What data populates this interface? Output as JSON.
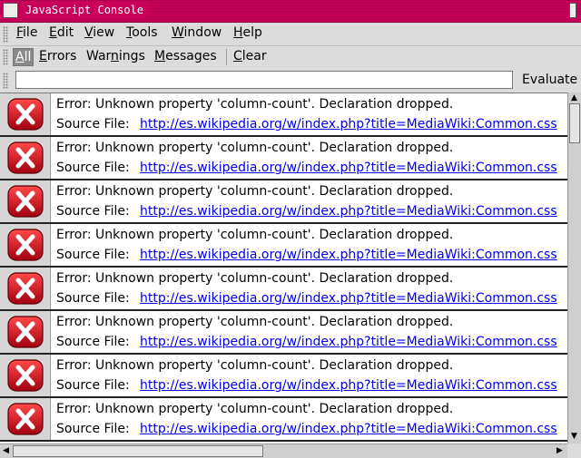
{
  "window": {
    "title": "JavaScript Console"
  },
  "menu": {
    "items": [
      "File",
      "Edit",
      "View",
      "Tools",
      "Window",
      "Help"
    ]
  },
  "filters": {
    "items": [
      "All",
      "Errors",
      "Warnings",
      "Messages"
    ],
    "active": "All",
    "clear_label": "Clear"
  },
  "evaluate": {
    "input_value": "",
    "button_label": "Evaluate"
  },
  "entries": [
    {
      "type": "error-icon",
      "message": "Error:  Unknown property 'column-count'. Declaration dropped.",
      "source_label": "Source File:",
      "source_url": "http://es.wikipedia.org/w/index.php?title=MediaWiki:Common.css"
    },
    {
      "type": "error-icon",
      "message": "Error:  Unknown property 'column-count'. Declaration dropped.",
      "source_label": "Source File:",
      "source_url": "http://es.wikipedia.org/w/index.php?title=MediaWiki:Common.css"
    },
    {
      "type": "error-icon",
      "message": "Error:  Unknown property 'column-count'. Declaration dropped.",
      "source_label": "Source File:",
      "source_url": "http://es.wikipedia.org/w/index.php?title=MediaWiki:Common.css"
    },
    {
      "type": "error-icon",
      "message": "Error:  Unknown property 'column-count'. Declaration dropped.",
      "source_label": "Source File:",
      "source_url": "http://es.wikipedia.org/w/index.php?title=MediaWiki:Common.css"
    },
    {
      "type": "error-icon",
      "message": "Error:  Unknown property 'column-count'. Declaration dropped.",
      "source_label": "Source File:",
      "source_url": "http://es.wikipedia.org/w/index.php?title=MediaWiki:Common.css"
    },
    {
      "type": "error-icon",
      "message": "Error:  Unknown property 'column-count'. Declaration dropped.",
      "source_label": "Source File:",
      "source_url": "http://es.wikipedia.org/w/index.php?title=MediaWiki:Common.css"
    },
    {
      "type": "error-icon",
      "message": "Error:  Unknown property 'column-count'. Declaration dropped.",
      "source_label": "Source File:",
      "source_url": "http://es.wikipedia.org/w/index.php?title=MediaWiki:Common.css"
    },
    {
      "type": "error-icon",
      "message": "Error:  Unknown property 'column-count'. Declaration dropped.",
      "source_label": "Source File:",
      "source_url": "http://es.wikipedia.org/w/index.php?title=MediaWiki:Common.css"
    }
  ],
  "colors": {
    "titlebar": "#c8005a",
    "link": "#0000ee",
    "error_icon": "#c0001a"
  }
}
